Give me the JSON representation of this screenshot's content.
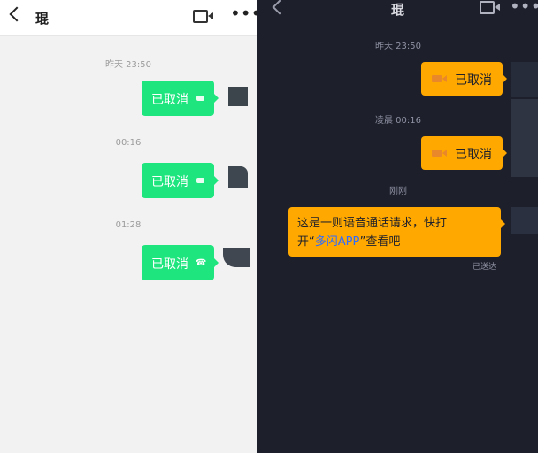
{
  "left": {
    "header": {
      "title": "琨",
      "back_icon": "chevron-left-icon",
      "video_icon": "video-camera-icon",
      "more_icon": "more-horizontal-icon",
      "more_glyph": "•••"
    },
    "messages": [
      {
        "timestamp": "昨天 23:50",
        "text": "已取消",
        "icon": "video-camera-icon"
      },
      {
        "timestamp": "00:16",
        "text": "已取消",
        "icon": "video-camera-icon"
      },
      {
        "timestamp": "01:28",
        "text": "已取消",
        "icon": "phone-icon"
      }
    ],
    "bubble_color": "#1fe57f"
  },
  "right": {
    "header": {
      "title": "琨",
      "back_icon": "chevron-left-icon",
      "video_icon": "video-camera-icon",
      "more_icon": "more-horizontal-icon",
      "more_glyph": "•••"
    },
    "messages": [
      {
        "timestamp": "昨天 23:50",
        "text": "已取消",
        "icon": "video-camera-icon"
      },
      {
        "timestamp": "凌晨 00:16",
        "text": "已取消",
        "icon": "video-camera-icon"
      }
    ],
    "text_message": {
      "timestamp": "刚刚",
      "line1": "这是一则语音通话请求，快打",
      "line2_prefix": "开“",
      "link": "多闪APP",
      "line2_suffix": "”查看吧",
      "status": "已送达"
    },
    "bubble_color": "#ffa800",
    "link_color": "#2f6bff"
  }
}
